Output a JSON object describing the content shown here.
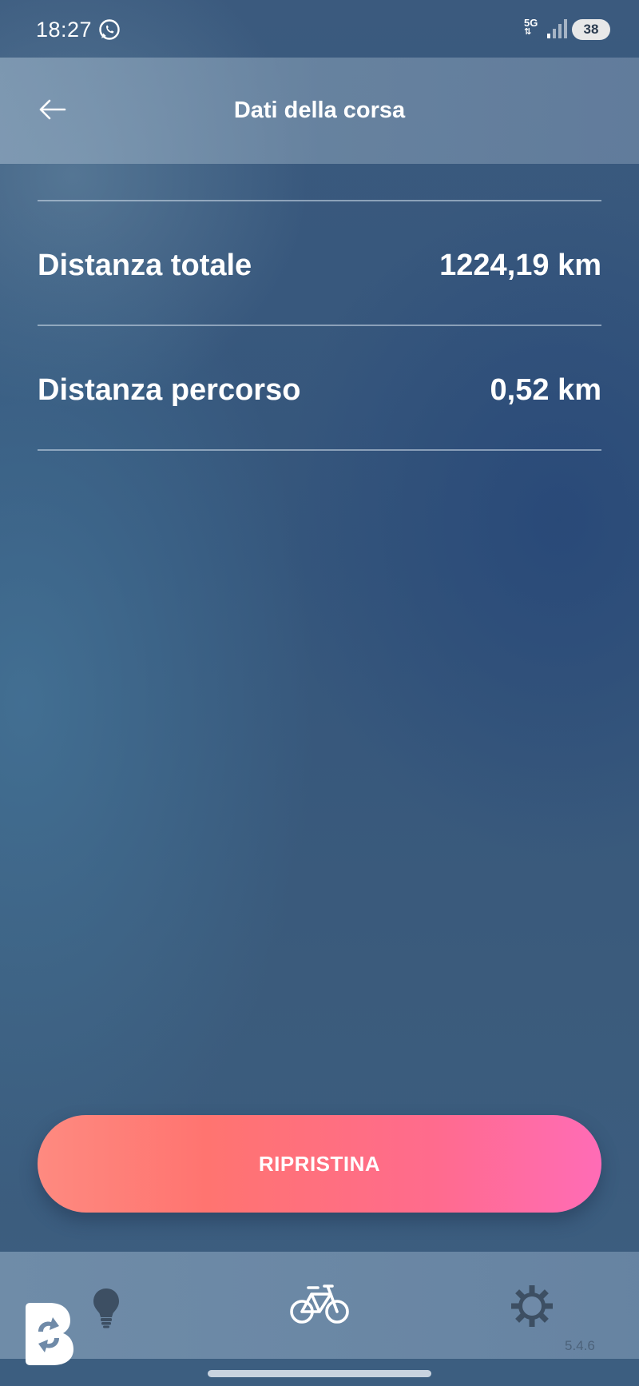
{
  "status_bar": {
    "time": "18:27",
    "network_label": "5G",
    "battery_level": "38",
    "icons": [
      "whatsapp-icon",
      "signal-icon",
      "battery-icon"
    ]
  },
  "header": {
    "title": "Dati della corsa",
    "back_icon": "arrow-left-icon"
  },
  "rows": [
    {
      "label": "Distanza totale",
      "value": "1224,19 km"
    },
    {
      "label": "Distanza percorso",
      "value": "0,52 km"
    }
  ],
  "actions": {
    "reset_label": "RIPRISTINA"
  },
  "bottom_nav": {
    "items": [
      {
        "icon": "lightbulb-icon"
      },
      {
        "icon": "bicycle-icon",
        "active": true
      },
      {
        "icon": "gear-icon"
      }
    ],
    "version": "5.4.6"
  },
  "colors": {
    "accent_start": "#fe8a80",
    "accent_end": "#ff6cb6",
    "background": "#35567c"
  }
}
